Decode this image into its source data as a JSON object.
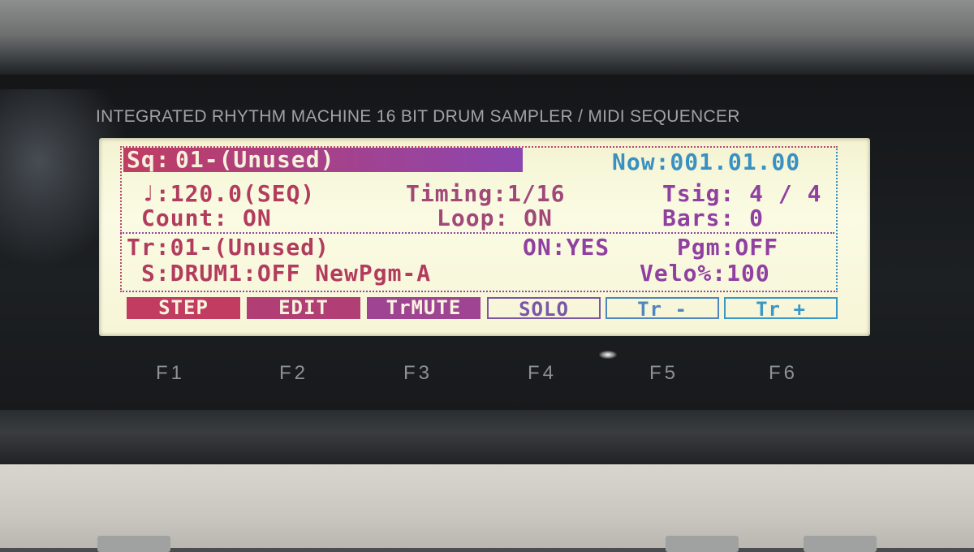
{
  "device": {
    "brand_line": "INTEGRATED RHYTHM MACHINE  16 BIT DRUM SAMPLER / MIDI SEQUENCER"
  },
  "lcd": {
    "seq_label": "Sq:",
    "seq_value": "01-(Unused)",
    "now": "Now:001.01.00",
    "tempo": "♩:120.0(SEQ)",
    "timing": "Timing:1/16",
    "tsig": "Tsig: 4 / 4",
    "count": "Count: ON",
    "loop": "Loop: ON",
    "bars": "Bars: 0",
    "track": "Tr:01-(Unused)",
    "on": "ON:YES",
    "pgm": "Pgm:OFF",
    "sample": "S:DRUM1:OFF NewPgm-A",
    "velo": "Velo%:100"
  },
  "softkeys": [
    {
      "label": "STEP",
      "style": "filled",
      "color": "#c13c60"
    },
    {
      "label": "EDIT",
      "style": "filled",
      "color": "#b13e74"
    },
    {
      "label": "TrMUTE",
      "style": "filled",
      "color": "#9e4492"
    },
    {
      "label": "SOLO",
      "style": "outline",
      "color": "#7a56a8"
    },
    {
      "label": "Tr -",
      "style": "outline",
      "color": "#4f86bf"
    },
    {
      "label": "Tr +",
      "style": "outline",
      "color": "#3a98c8"
    }
  ],
  "function_keys": [
    "F1",
    "F2",
    "F3",
    "F4",
    "F5",
    "F6"
  ],
  "colors": {
    "lcd_background": "#f8f7dc",
    "text_red": "#b23c5e",
    "text_purple": "#9040a0",
    "text_blue": "#3a90c0"
  }
}
